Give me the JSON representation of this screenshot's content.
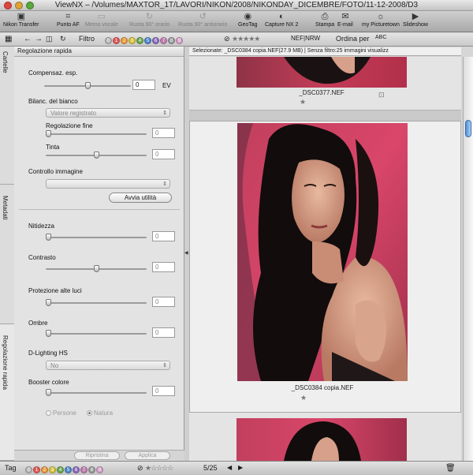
{
  "window": {
    "title": "ViewNX – /Volumes/MAXTOR_1T/LAVORI/NIKON/2008/NIKONDAY_DICEMBRE/FOTO/11-12-2008/D3"
  },
  "toolbar": {
    "items": [
      {
        "label": "Nikon Transfer",
        "icon": "camera-icon",
        "glyph": "▣",
        "enabled": true
      },
      {
        "label": "Punto AF",
        "icon": "focus-point-icon",
        "glyph": "⌗",
        "enabled": true
      },
      {
        "label": "Memo vocale",
        "icon": "voice-memo-icon",
        "glyph": "▭",
        "enabled": false
      },
      {
        "label": "Ruota 90° orario",
        "icon": "rotate-cw-icon",
        "glyph": "↻",
        "enabled": false
      },
      {
        "label": "Ruota 90° antiorario",
        "icon": "rotate-ccw-icon",
        "glyph": "↺",
        "enabled": false
      },
      {
        "label": "GeoTag",
        "icon": "geotag-icon",
        "glyph": "◉",
        "enabled": true
      },
      {
        "label": "Capture NX 2",
        "icon": "capture-nx-icon",
        "glyph": "◐",
        "enabled": true
      },
      {
        "label": "Stampa",
        "icon": "print-icon",
        "glyph": "⎙",
        "enabled": true
      },
      {
        "label": "E-mail",
        "icon": "email-icon",
        "glyph": "✉",
        "enabled": true
      },
      {
        "label": "my Picturetown",
        "icon": "picturetown-icon",
        "glyph": "☼",
        "enabled": true
      },
      {
        "label": "Slideshow",
        "icon": "slideshow-icon",
        "glyph": "▶",
        "enabled": true
      }
    ]
  },
  "filterbar": {
    "filter_label": "Filtro",
    "labels": [
      "0",
      "1",
      "2",
      "3",
      "4",
      "5",
      "6",
      "7",
      "8",
      "9"
    ],
    "label_colors": [
      "#b8b8b8",
      "#e05a5a",
      "#e89a3c",
      "#d9c43a",
      "#6aa84f",
      "#4a86c8",
      "#8a6bbe",
      "#c07fb0",
      "#9b9b9b",
      "#d4a0c8"
    ],
    "stars": "★★★★★",
    "format_filter": "NEF|NRW",
    "sort_label": "Ordina per",
    "sort_value": "ABC"
  },
  "tabs": {
    "cartelle": "Cartelle",
    "metadati": "Metadati",
    "regolazione": "Regolazione rapida"
  },
  "panel": {
    "title": "Regolazione rapida",
    "exposure": {
      "label": "Compensaz. esp.",
      "value": "0",
      "unit": "EV",
      "level": 0.5
    },
    "white_balance": {
      "label": "Bilanc. del bianco",
      "value": "Valore registrato"
    },
    "fine_tune": {
      "label": "Regolazione fine",
      "value": "0",
      "level": 0.0
    },
    "tint": {
      "label": "Tinta",
      "value": "0",
      "level": 0.5
    },
    "image_control": {
      "label": "Controllo immagine",
      "value": ""
    },
    "launch_button": "Avvia utilità",
    "sharpness": {
      "label": "Nitidezza",
      "value": "0",
      "level": 0.0
    },
    "contrast": {
      "label": "Contrasto",
      "value": "0",
      "level": 0.5
    },
    "highlight": {
      "label": "Protezione alte luci",
      "value": "0",
      "level": 0.0
    },
    "shadows": {
      "label": "Ombre",
      "value": "0",
      "level": 0.0
    },
    "dlighting": {
      "label": "D-Lighting HS",
      "value": "No"
    },
    "booster": {
      "label": "Booster colore",
      "value": "0",
      "level": 0.0
    },
    "radio_people": "Persone",
    "radio_nature": "Natura",
    "reset_button": "Ripristina",
    "apply_button": "Applica"
  },
  "infobar": "Selezionate: _DSC0384 copia.NEF(27.9 MB) | Senza filtro:25 immagini visualizz",
  "thumbs": [
    {
      "filename": "_DSC0377.NEF"
    },
    {
      "filename": "_DSC0384 copia.NEF"
    },
    {
      "filename": ""
    }
  ],
  "bottombar": {
    "tag_label": "Tag",
    "labels": [
      "0",
      "1",
      "2",
      "3",
      "4",
      "5",
      "6",
      "7",
      "8",
      "9"
    ],
    "stars": "★☆☆☆☆",
    "page": "5/25"
  },
  "colors": {
    "accent": "#4d8fd8",
    "photo_bg": "#c23a55"
  }
}
